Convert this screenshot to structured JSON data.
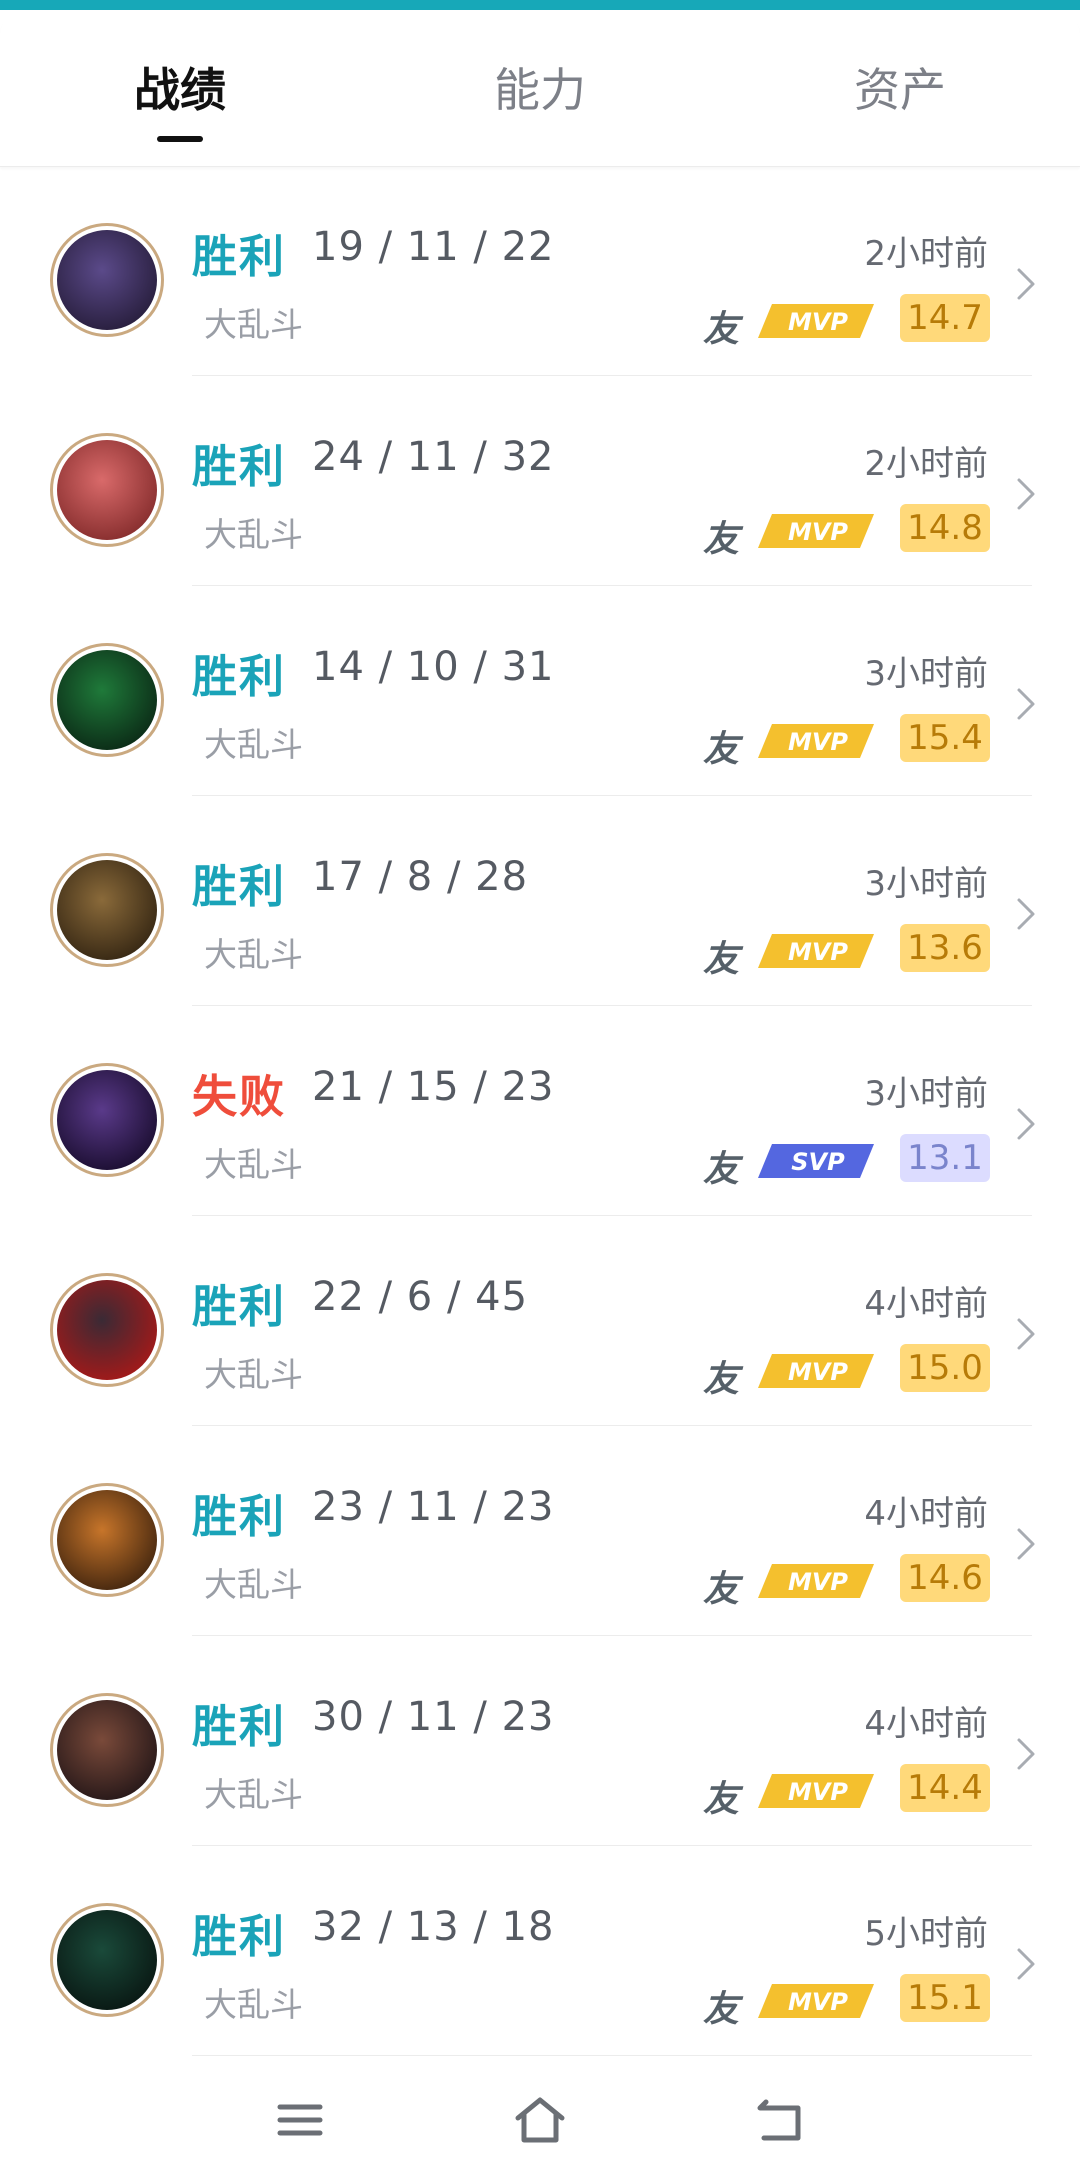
{
  "tabs": [
    {
      "label": "战绩",
      "active": true
    },
    {
      "label": "能力",
      "active": false
    },
    {
      "label": "资产",
      "active": false
    }
  ],
  "colors": {
    "win": "#1aa3b8",
    "loss": "#ef4d3b",
    "mvp_gold": "#f4c02e",
    "svp_blue": "#5467e0",
    "accent": "#17a8b8"
  },
  "matches": [
    {
      "result": "胜利",
      "outcome": "win",
      "kda": "19 / 11 / 22",
      "mode": "大乱斗",
      "time": "2小时前",
      "friend": "友",
      "badge": "MVP",
      "score": "14.7"
    },
    {
      "result": "胜利",
      "outcome": "win",
      "kda": "24 / 11 / 32",
      "mode": "大乱斗",
      "time": "2小时前",
      "friend": "友",
      "badge": "MVP",
      "score": "14.8"
    },
    {
      "result": "胜利",
      "outcome": "win",
      "kda": "14 / 10 / 31",
      "mode": "大乱斗",
      "time": "3小时前",
      "friend": "友",
      "badge": "MVP",
      "score": "15.4"
    },
    {
      "result": "胜利",
      "outcome": "win",
      "kda": "17 / 8 / 28",
      "mode": "大乱斗",
      "time": "3小时前",
      "friend": "友",
      "badge": "MVP",
      "score": "13.6"
    },
    {
      "result": "失败",
      "outcome": "loss",
      "kda": "21 / 15 / 23",
      "mode": "大乱斗",
      "time": "3小时前",
      "friend": "友",
      "badge": "SVP",
      "score": "13.1"
    },
    {
      "result": "胜利",
      "outcome": "win",
      "kda": "22 / 6 / 45",
      "mode": "大乱斗",
      "time": "4小时前",
      "friend": "友",
      "badge": "MVP",
      "score": "15.0"
    },
    {
      "result": "胜利",
      "outcome": "win",
      "kda": "23 / 11 / 23",
      "mode": "大乱斗",
      "time": "4小时前",
      "friend": "友",
      "badge": "MVP",
      "score": "14.6"
    },
    {
      "result": "胜利",
      "outcome": "win",
      "kda": "30 / 11 / 23",
      "mode": "大乱斗",
      "time": "4小时前",
      "friend": "友",
      "badge": "MVP",
      "score": "14.4"
    },
    {
      "result": "胜利",
      "outcome": "win",
      "kda": "32 / 13 / 18",
      "mode": "大乱斗",
      "time": "5小时前",
      "friend": "友",
      "badge": "MVP",
      "score": "15.1"
    }
  ],
  "navbar": [
    {
      "icon": "menu-icon"
    },
    {
      "icon": "home-icon"
    },
    {
      "icon": "back-icon"
    }
  ]
}
